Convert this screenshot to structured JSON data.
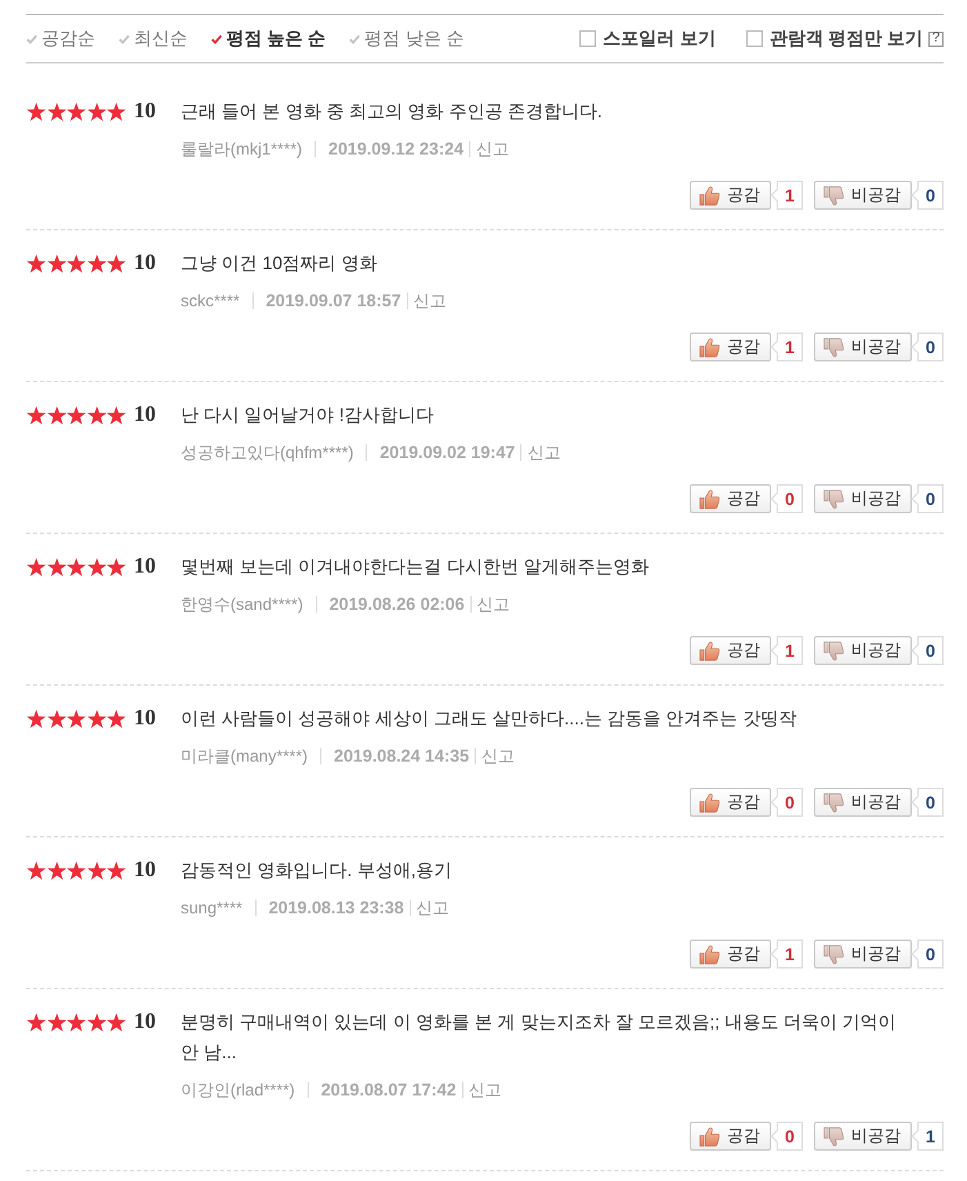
{
  "filter_bar": {
    "sort_options": [
      {
        "label": "공감순",
        "selected": false
      },
      {
        "label": "최신순",
        "selected": false
      },
      {
        "label": "평점 높은 순",
        "selected": true
      },
      {
        "label": "평점 낮은 순",
        "selected": false
      }
    ],
    "toggles": [
      {
        "label": "스포일러 보기",
        "checked": false
      },
      {
        "label": "관람객 평점만 보기",
        "checked": false
      }
    ],
    "help": "?"
  },
  "reviews": [
    {
      "stars": 5,
      "score": "10",
      "text": "근래 들어 본 영화 중 최고의 영화 주인공 존경합니다.",
      "author": "룰랄라(mkj1****)",
      "date": "2019.09.12 23:24",
      "report": "신고",
      "like_label": "공감",
      "likes": "1",
      "dislike_label": "비공감",
      "dislikes": "0"
    },
    {
      "stars": 5,
      "score": "10",
      "text": "그냥 이건 10점짜리 영화",
      "author": "sckc****",
      "date": "2019.09.07 18:57",
      "report": "신고",
      "like_label": "공감",
      "likes": "1",
      "dislike_label": "비공감",
      "dislikes": "0"
    },
    {
      "stars": 5,
      "score": "10",
      "text": "난 다시 일어날거야 !감사합니다",
      "author": "성공하고있다(qhfm****)",
      "date": "2019.09.02 19:47",
      "report": "신고",
      "like_label": "공감",
      "likes": "0",
      "dislike_label": "비공감",
      "dislikes": "0"
    },
    {
      "stars": 5,
      "score": "10",
      "text": "몇번째 보는데 이겨내야한다는걸 다시한번 알게해주는영화",
      "author": "한영수(sand****)",
      "date": "2019.08.26 02:06",
      "report": "신고",
      "like_label": "공감",
      "likes": "1",
      "dislike_label": "비공감",
      "dislikes": "0"
    },
    {
      "stars": 5,
      "score": "10",
      "text": "이런 사람들이 성공해야 세상이 그래도 살만하다....는 감동을 안겨주는 갓띵작",
      "author": "미라클(many****)",
      "date": "2019.08.24 14:35",
      "report": "신고",
      "like_label": "공감",
      "likes": "0",
      "dislike_label": "비공감",
      "dislikes": "0"
    },
    {
      "stars": 5,
      "score": "10",
      "text": "감동적인 영화입니다. 부성애,용기",
      "author": "sung****",
      "date": "2019.08.13 23:38",
      "report": "신고",
      "like_label": "공감",
      "likes": "1",
      "dislike_label": "비공감",
      "dislikes": "0"
    },
    {
      "stars": 5,
      "score": "10",
      "text": "분명히 구매내역이 있는데 이 영화를 본 게 맞는지조차 잘 모르겠음;; 내용도 더욱이 기억이 안 남...",
      "author": "이강인(rlad****)",
      "date": "2019.08.07 17:42",
      "report": "신고",
      "like_label": "공감",
      "likes": "0",
      "dislike_label": "비공감",
      "dislikes": "1"
    }
  ]
}
